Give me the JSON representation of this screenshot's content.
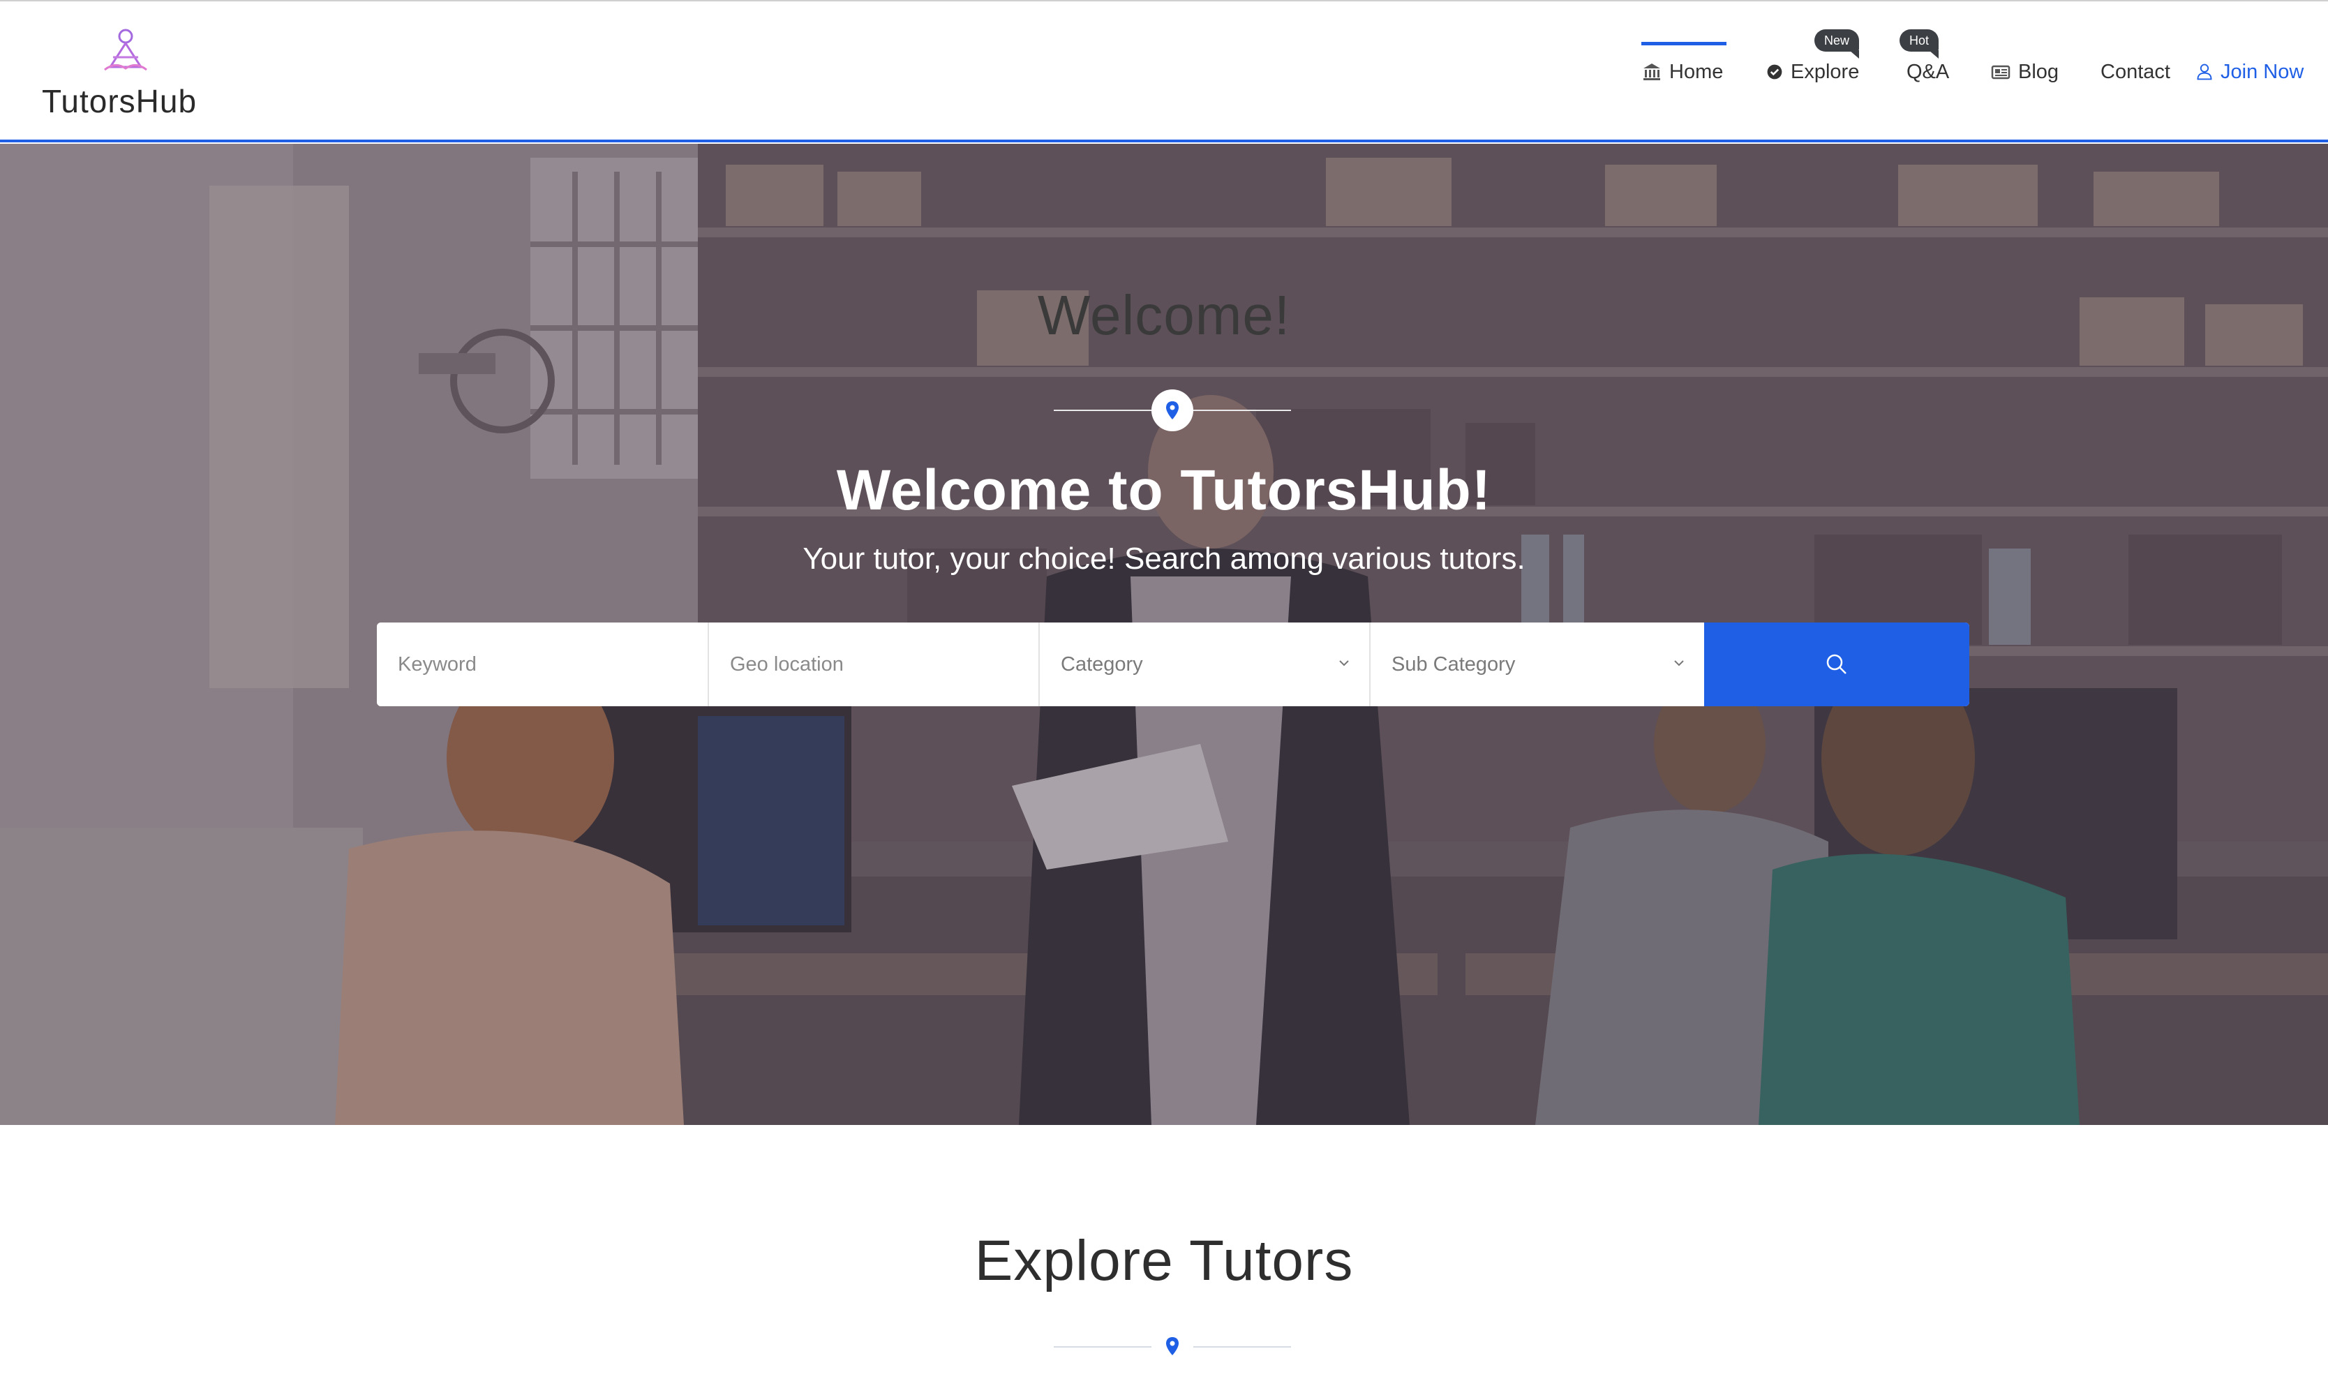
{
  "brand": {
    "name": "TutorsHub",
    "accent": "#1f5fe6",
    "logo_colors": [
      "#a36ae0",
      "#e07ad0"
    ]
  },
  "nav": {
    "items": [
      {
        "label": "Home",
        "icon": "bank-icon",
        "active": true
      },
      {
        "label": "Explore",
        "icon": "check-circle-icon",
        "badge": "New"
      },
      {
        "label": "Q&A",
        "badge": "Hot"
      },
      {
        "label": "Blog",
        "icon": "newspaper-icon"
      },
      {
        "label": "Contact"
      },
      {
        "label": "Join Now",
        "icon": "user-icon"
      }
    ]
  },
  "hero": {
    "welcome": "Welcome!",
    "title": "Welcome to TutorsHub!",
    "subtitle": "Your tutor, your choice! Search among various tutors.",
    "divider_icon": "map-pin-icon"
  },
  "search": {
    "keyword_placeholder": "Keyword",
    "geo_placeholder": "Geo location",
    "category_label": "Category",
    "subcategory_label": "Sub Category",
    "button_icon": "search-icon"
  },
  "explore": {
    "title": "Explore Tutors",
    "divider_icon": "map-pin-icon"
  }
}
